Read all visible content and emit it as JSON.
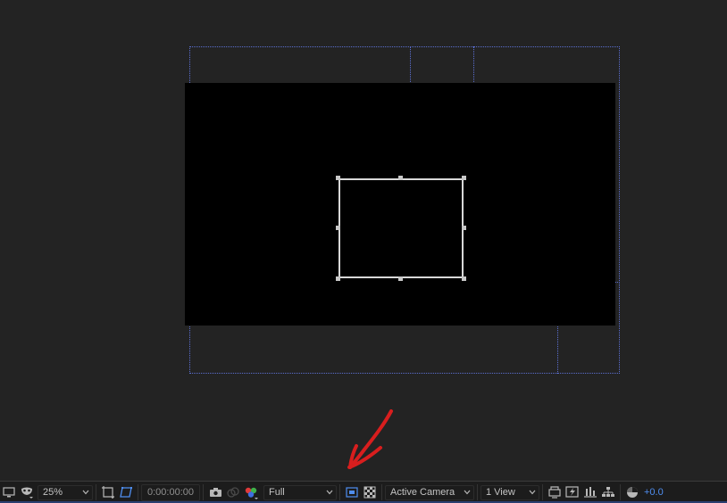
{
  "toolbar": {
    "magnification": "25%",
    "timecode": "0:00:00:00",
    "resolution": "Full",
    "camera": "Active Camera",
    "views": "1 View",
    "exposure": "+0.0"
  },
  "colors": {
    "guide": "#5b6fd1",
    "annotation_arrow": "#d81e1e",
    "accent_blue": "#4f8ef0",
    "background": "#232323"
  },
  "icons": [
    "monitor-icon",
    "mask-icon",
    "safe-zones-icon",
    "toggle-mask-visibility-icon",
    "snapshot-camera-icon",
    "show-snapshot-icon",
    "color-channels-icon",
    "region-of-interest-icon",
    "transparency-grid-icon",
    "3d-view-icon",
    "fast-previews-icon",
    "timeline-icon",
    "flowchart-icon",
    "reset-exposure-icon"
  ]
}
